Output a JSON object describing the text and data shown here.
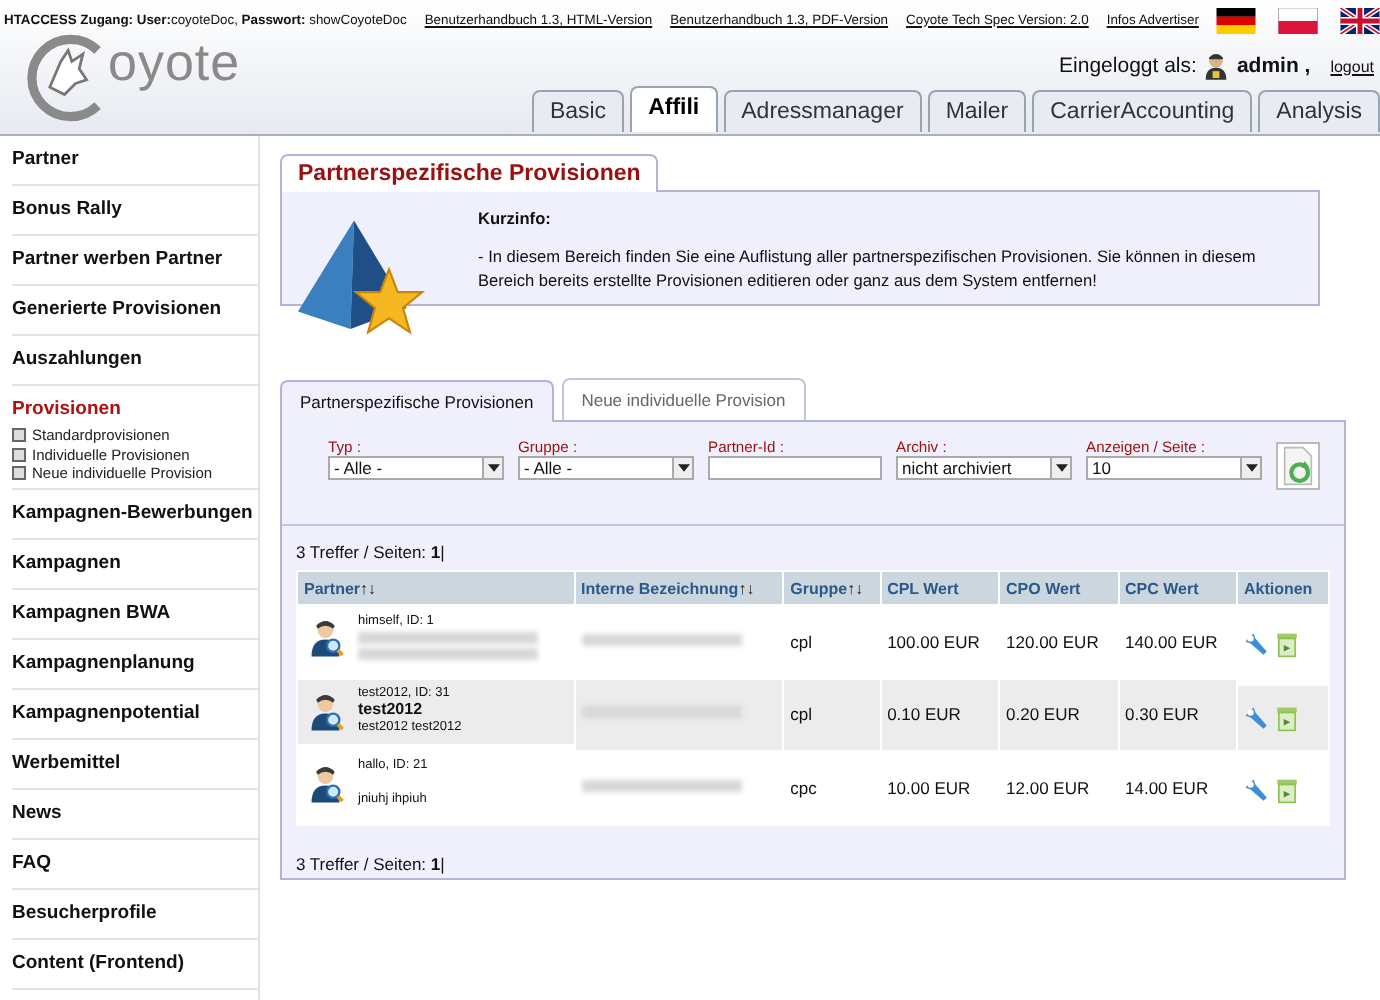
{
  "top_bar": {
    "access_label": "HTACCESS Zugang: User:",
    "access_user": "coyoteDoc,",
    "password_label": "Passwort:",
    "password": "showCoyoteDoc",
    "links": [
      "Benutzerhandbuch 1.3, HTML-Version",
      "Benutzerhandbuch 1.3, PDF-Version",
      "Coyote Tech Spec Version: 2.0",
      "Infos Advertiser"
    ],
    "flags": [
      {
        "kind": "de"
      },
      {
        "kind": "pl"
      },
      {
        "kind": "uk"
      }
    ]
  },
  "logo": "oyote",
  "login": {
    "label": "Eingeloggt als:",
    "user": "admin ,",
    "logout": "logout"
  },
  "tabs": [
    {
      "label": "Basic",
      "selected": false
    },
    {
      "label": "Affili",
      "selected": true
    },
    {
      "label": "Adressmanager",
      "selected": false
    },
    {
      "label": "Mailer",
      "selected": false
    },
    {
      "label": "CarrierAccounting",
      "selected": false
    },
    {
      "label": "Analysis",
      "selected": false
    }
  ],
  "sidebar": {
    "items": [
      {
        "label": "Partner",
        "selected": false
      },
      {
        "label": "Bonus Rally",
        "selected": false
      },
      {
        "label": "Partner werben Partner",
        "selected": false
      },
      {
        "label": "Generierte Provisionen",
        "selected": false
      },
      {
        "label": "Auszahlungen",
        "selected": false
      },
      {
        "label": "Provisionen",
        "selected": true,
        "children": [
          {
            "label": "Standardprovisionen"
          },
          {
            "label": "Individuelle Provisionen"
          },
          {
            "label": "Neue individuelle Provision"
          }
        ]
      },
      {
        "label": "Kampagnen-Bewerbungen",
        "selected": false
      },
      {
        "label": "Kampagnen",
        "selected": false
      },
      {
        "label": "Kampagnen BWA",
        "selected": false
      },
      {
        "label": "Kampagnenplanung",
        "selected": false
      },
      {
        "label": "Kampagnenpotential",
        "selected": false
      },
      {
        "label": "Werbemittel",
        "selected": false
      },
      {
        "label": "News",
        "selected": false
      },
      {
        "label": "FAQ",
        "selected": false
      },
      {
        "label": "Besucherprofile",
        "selected": false
      },
      {
        "label": "Content (Frontend)",
        "selected": false
      }
    ]
  },
  "page_title": "Partnerspezifische Provisionen",
  "info": {
    "heading": "Kurzinfo:",
    "text": "- In diesem Bereich finden Sie eine Auflistung aller partnerspezifischen Provisionen. Sie können in diesem Bereich bereits erstellte Provisionen editieren oder ganz aus dem System entfernen!"
  },
  "sub_tabs": [
    {
      "label": "Partnerspezifische Provisionen",
      "selected": true
    },
    {
      "label": "Neue individuelle Provision",
      "selected": false
    }
  ],
  "filters": [
    {
      "kind": "select",
      "label": "Typ :",
      "value": "- Alle -"
    },
    {
      "kind": "select",
      "label": "Gruppe :",
      "value": "- Alle -"
    },
    {
      "kind": "input",
      "label": "Partner-Id :"
    },
    {
      "kind": "select",
      "label": "Archiv :",
      "value": "nicht archiviert"
    },
    {
      "kind": "select",
      "label": "Anzeigen / Seite :",
      "value": "10"
    }
  ],
  "pagination_top": "3 Treffer / Seiten: **1**|",
  "table": {
    "columns": [
      {
        "label": "Partner",
        "sort": "↑↓"
      },
      {
        "label": "Interne Bezeichnung",
        "sort": "↑↓"
      },
      {
        "label": "Gruppe",
        "sort": "↑↓"
      },
      {
        "label": "CPL Wert"
      },
      {
        "label": "CPO Wert"
      },
      {
        "label": "CPC Wert"
      },
      {
        "label": "Aktionen"
      }
    ],
    "rows": [
      {
        "partner": [
          {
            "kind": "plain",
            "text": "himself, ID: 1"
          },
          {
            "kind": "blurred"
          },
          {
            "kind": "blurred"
          }
        ],
        "group": "cpl",
        "cpl": "100.00 EUR",
        "cpo": "120.00 EUR",
        "cpc": "140.00 EUR"
      },
      {
        "partner": [
          {
            "kind": "plain",
            "text": "test2012, ID: 31"
          },
          {
            "kind": "bold",
            "text": "test2012"
          },
          {
            "kind": "plain",
            "text": "test2012 test2012"
          }
        ],
        "group": "cpl",
        "cpl": "0.10 EUR",
        "cpo": "0.20 EUR",
        "cpc": "0.30 EUR"
      },
      {
        "partner": [
          {
            "kind": "plain",
            "text": "hallo, ID: 21"
          },
          {
            "kind": "gap"
          },
          {
            "kind": "plain",
            "text": "jniuhj ihpiuh"
          }
        ],
        "group": "cpc",
        "cpl": "10.00 EUR",
        "cpo": "12.00 EUR",
        "cpc": "14.00 EUR"
      }
    ]
  },
  "pagination_bottom": "3 Treffer / Seiten: **1**|"
}
